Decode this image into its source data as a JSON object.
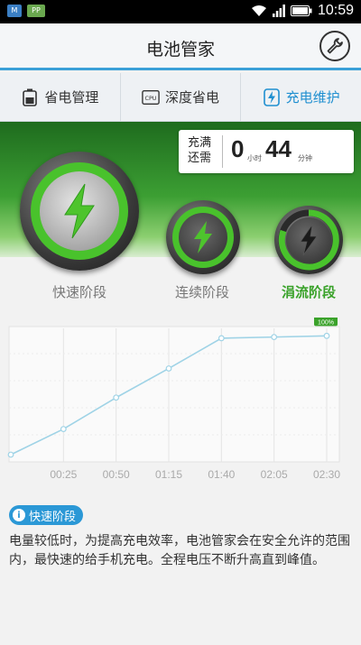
{
  "status_bar": {
    "time": "10:59",
    "left_badges": [
      "M",
      "PP"
    ]
  },
  "header": {
    "title": "电池管家",
    "settings_icon": "wrench-icon"
  },
  "tabs": [
    {
      "label": "省电管理",
      "icon": "battery-icon"
    },
    {
      "label": "深度省电",
      "icon": "cpu-icon"
    },
    {
      "label": "充电维护",
      "icon": "lightning-icon",
      "active": true
    }
  ],
  "charge": {
    "label_line1": "充满",
    "label_line2": "还需",
    "hours": "0",
    "hours_unit": "小时",
    "minutes": "44",
    "minutes_unit": "分钟"
  },
  "stages": [
    {
      "label": "快速阶段"
    },
    {
      "label": "连续阶段"
    },
    {
      "label": "涓流阶段",
      "active": true
    }
  ],
  "chart_data": {
    "type": "line",
    "x_ticks": [
      "00:25",
      "00:50",
      "01:15",
      "01:40",
      "02:05",
      "02:30"
    ],
    "x": [
      "00:00",
      "00:25",
      "00:50",
      "01:15",
      "01:40",
      "02:05",
      "02:30"
    ],
    "values": [
      0,
      22,
      49,
      74,
      100,
      101,
      102
    ],
    "ylim": [
      0,
      110
    ],
    "badge": "100%",
    "line_color": "#9fd3e6"
  },
  "info": {
    "badge": "快速阶段",
    "badge_icon": "i",
    "text": "电量较低时，为提高充电效率，电池管家会在安全允许的范围内，最快速的给手机充电。全程电压不断升高直到峰值。"
  },
  "colors": {
    "accent": "#3aa0d8",
    "green": "#3aa22a"
  }
}
